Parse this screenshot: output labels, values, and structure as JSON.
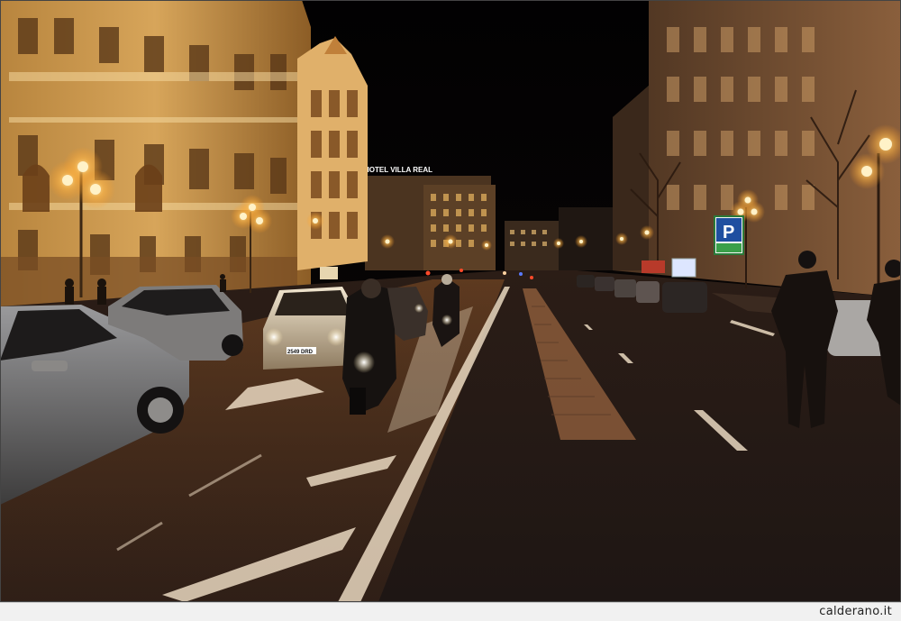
{
  "photo": {
    "hotel_sign": "HOTEL VILLA REAL",
    "parking_sign": "P",
    "taxi_plate": "2549 DRD"
  },
  "footer": {
    "credit": "calderano.it"
  }
}
